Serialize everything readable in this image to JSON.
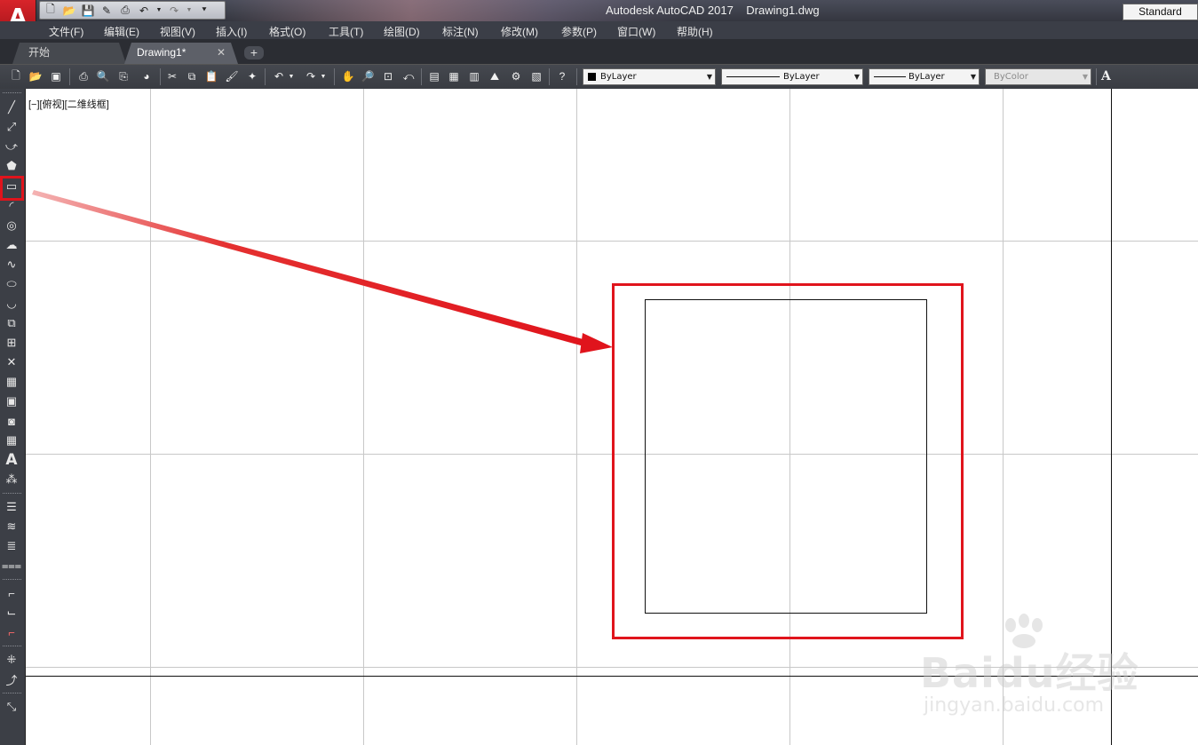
{
  "window": {
    "title": "Autodesk AutoCAD 2017    Drawing1.dwg",
    "app_logo": "A"
  },
  "menu": {
    "items": [
      "文件(F)",
      "编辑(E)",
      "视图(V)",
      "插入(I)",
      "格式(O)",
      "工具(T)",
      "绘图(D)",
      "标注(N)",
      "修改(M)",
      "参数(P)",
      "窗口(W)",
      "帮助(H)"
    ]
  },
  "tabs": {
    "start": "开始",
    "drawing": "Drawing1*",
    "add": "+"
  },
  "properties": {
    "layer_color": "ByLayer",
    "linetype": "ByLayer",
    "lineweight": "ByLayer",
    "plot_style": "ByColor",
    "text_style": "Standard"
  },
  "viewport": {
    "label": "[−][俯视][二维线框]"
  },
  "annotation": {
    "highlight_color": "#e0141c",
    "target": "rectangle-tool"
  },
  "watermark": {
    "main": "Baidu经验",
    "sub": "jingyan.baidu.com"
  },
  "icons": {
    "left_toolbar": [
      "line-icon",
      "construction-line-icon",
      "polyline-icon",
      "polygon-icon",
      "rectangle-icon",
      "arc-icon",
      "circle-icon",
      "revision-cloud-icon",
      "spline-icon",
      "ellipse-icon",
      "ellipse-arc-icon",
      "insert-block-icon",
      "make-block-icon",
      "point-icon",
      "hatch-icon",
      "gradient-icon",
      "region-icon",
      "table-icon",
      "multiline-text-icon",
      "add-selected-icon"
    ]
  }
}
